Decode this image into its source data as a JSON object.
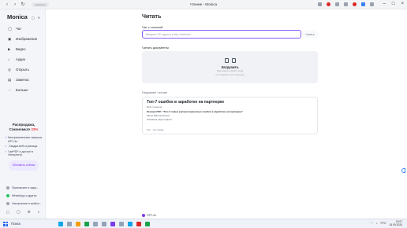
{
  "browser": {
    "url": "monica.im",
    "window_title": "Чтение - Monica"
  },
  "sidebar": {
    "brand": "Monica",
    "items": [
      {
        "label": "Чат",
        "icon": "chat-icon"
      },
      {
        "label": "Изображения",
        "icon": "image-icon"
      },
      {
        "label": "Видео",
        "icon": "video-icon"
      },
      {
        "label": "Аудио",
        "icon": "audio-icon"
      },
      {
        "label": "Открыть",
        "icon": "compass-icon"
      },
      {
        "label": "Заметка",
        "icon": "note-icon"
      },
      {
        "label": "Больше",
        "icon": "more-icon"
      }
    ],
    "promo": {
      "title_line1": "Распродажа,",
      "title_line2": "Сэкономьте",
      "percent": "33%",
      "features": [
        "Неограниченные запросы GPT-4o",
        "Сводка веб-страницы",
        "ЧатPDF и доступ в Интернету"
      ],
      "upgrade_label": "Обновить сейчас"
    },
    "links": [
      "Пригласите и зара...",
      "WhatsApp и других",
      "Настроение и мобил..."
    ]
  },
  "main": {
    "title": "Читать",
    "url_section_label": "Чат с ссылкой",
    "url_placeholder": "Введите ЕЕ адреса к http://website/...",
    "read_button": "Читать",
    "docs_section_label": "Читать документы",
    "upload_label": "Загрузить",
    "upload_sub_line1": "Перетащите файл сюда",
    "upload_sub_line2": "или нажмите для загрузки",
    "recent_label": "Недавнее чтение",
    "recent": {
      "title": "Топ-7 ошибок в заработке на партнерке",
      "meta": "Веб-страница",
      "summary": "Резюме PDF: \"Топ-7 самых распространенных ошибок в заработке на партнерке\"",
      "line1": "Автор: Виктор Ничьев",
      "line2": "Основные идеи и факты",
      "footer": "Чат · час назад"
    },
    "model_label": "GPT-4o"
  },
  "taskbar": {
    "search_label": "Поиск",
    "lang": "РУС",
    "time": "20:07",
    "date": "16.09.2024"
  }
}
